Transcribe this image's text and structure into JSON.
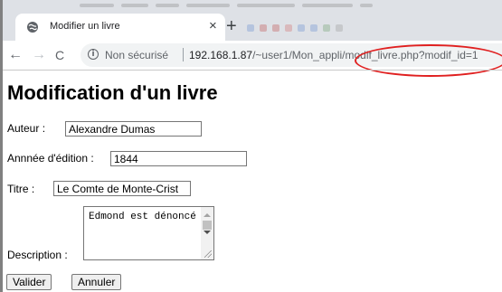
{
  "browser": {
    "tab": {
      "title": "Modifier un livre",
      "icon": "globe-icon",
      "close_label": "×"
    },
    "new_tab_label": "+",
    "nav": {
      "back_label": "←",
      "forward_label": "→",
      "reload_label": "C"
    },
    "address": {
      "security_label": "Non sécurisé",
      "url_host": "192.168.1.87",
      "url_path": "/~user1/Mon_appli/modif_livre.php?modif_id=1"
    },
    "highlight_color": "#e02020"
  },
  "page": {
    "title": "Modification d'un livre"
  },
  "form": {
    "author": {
      "label": "Auteur :",
      "value": "Alexandre Dumas"
    },
    "year": {
      "label": "Annnée d'édition :",
      "value": "1844"
    },
    "title": {
      "label": "Titre :",
      "value": "Le Comte de Monte-Crist"
    },
    "description": {
      "label": "Description :",
      "value": "Edmond est dénoncé"
    },
    "submit_label": "Valider",
    "cancel_label": "Annuler"
  }
}
